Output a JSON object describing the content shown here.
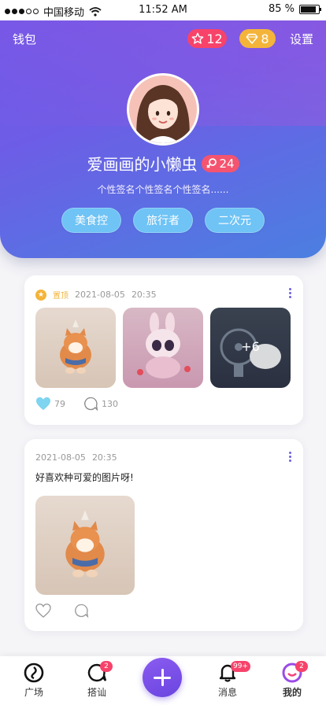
{
  "status_bar": {
    "carrier": "中国移动",
    "time": "11:52 AM",
    "battery": "85 %"
  },
  "header": {
    "wallet_label": "钱包",
    "star_count": "12",
    "gem_count": "8",
    "settings_label": "设置"
  },
  "profile": {
    "nickname": "爱画画的小懒虫",
    "gender_count": "24",
    "signature": "个性签名个性签名个性签名......",
    "tags": [
      "美食控",
      "旅行者",
      "二次元"
    ]
  },
  "posts": [
    {
      "pinned_label": "置顶",
      "date": "2021-08-05",
      "time": "20:35",
      "more_images_label": "+6",
      "likes": "79",
      "comments": "130"
    },
    {
      "date": "2021-08-05",
      "time": "20:35",
      "text": "好喜欢种可爱的图片呀!"
    }
  ],
  "bottom_nav": {
    "items": [
      {
        "label": "广场",
        "badge": ""
      },
      {
        "label": "搭讪",
        "badge": "2"
      },
      {
        "label": "消息",
        "badge": "99+"
      },
      {
        "label": "我的",
        "badge": "2"
      }
    ]
  },
  "colors": {
    "accent": "#6d5de6",
    "tag": "#6fc3f5",
    "star_badge": "#f7436a",
    "gem_badge": "#f4b43a"
  }
}
